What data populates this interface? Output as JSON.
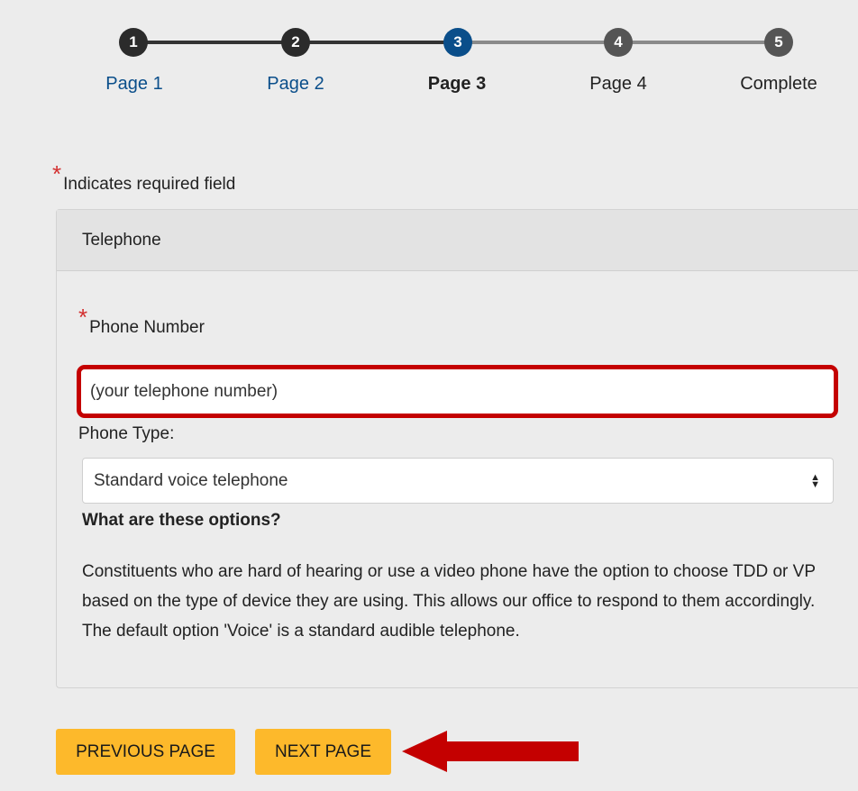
{
  "stepper": {
    "steps": [
      {
        "number": "1",
        "label": "Page 1",
        "state": "done"
      },
      {
        "number": "2",
        "label": "Page 2",
        "state": "done"
      },
      {
        "number": "3",
        "label": "Page 3",
        "state": "current"
      },
      {
        "number": "4",
        "label": "Page 4",
        "state": "todo"
      },
      {
        "number": "5",
        "label": "Complete",
        "state": "todo"
      }
    ]
  },
  "required_note": {
    "asterisk": "*",
    "text": "Indicates required field"
  },
  "panel": {
    "title": "Telephone",
    "phone": {
      "asterisk": "*",
      "label": "Phone Number",
      "placeholder": "(your telephone number)",
      "value": ""
    },
    "phone_type": {
      "label": "Phone Type:",
      "selected": "Standard voice telephone"
    },
    "options_heading": "What are these options?",
    "options_description": "Constituents who are hard of hearing or use a video phone have the option to choose TDD or VP based on the type of device they are using. This allows our office to respond to them accordingly. The default option 'Voice' is a standard audible telephone."
  },
  "buttons": {
    "previous": "PREVIOUS PAGE",
    "next": "NEXT PAGE"
  },
  "colors": {
    "accent_blue": "#0a4e8a",
    "button_yellow": "#fdb92b",
    "highlight_red": "#c40000",
    "required_red": "#d32f2f"
  }
}
